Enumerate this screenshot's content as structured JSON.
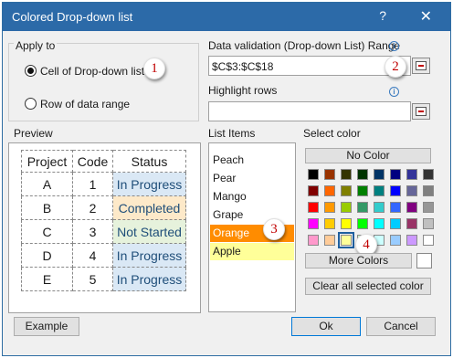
{
  "window": {
    "title": "Colored Drop-down list",
    "help": "?",
    "close": "✕"
  },
  "apply_to": {
    "label": "Apply to",
    "option_cell": "Cell of Drop-down list",
    "option_row": "Row of data range",
    "selected": "cell",
    "badge": "1"
  },
  "range": {
    "label": "Data validation (Drop-down List) Range",
    "value": "$C$3:$C$18",
    "badge": "2",
    "info_icon": "info-icon"
  },
  "highlight_rows": {
    "label": "Highlight rows",
    "value": "",
    "info_icon": "info-icon"
  },
  "preview": {
    "label": "Preview",
    "headers": [
      "Project",
      "Code",
      "Status"
    ],
    "rows": [
      {
        "project": "A",
        "code": "1",
        "status": "In Progress",
        "color": "#dae8f5"
      },
      {
        "project": "B",
        "code": "2",
        "status": "Completed",
        "color": "#fde9c9"
      },
      {
        "project": "C",
        "code": "3",
        "status": "Not Started",
        "color": "#e6f2dc"
      },
      {
        "project": "D",
        "code": "4",
        "status": "In Progress",
        "color": "#dae8f5"
      },
      {
        "project": "E",
        "code": "5",
        "status": "In Progress",
        "color": "#dae8f5"
      }
    ]
  },
  "list_items": {
    "label": "List Items",
    "items": [
      {
        "text": "Peach",
        "bg": "#ffffff",
        "color": "#1a1a1a"
      },
      {
        "text": "Pear",
        "bg": "#ffffff",
        "color": "#1a1a1a"
      },
      {
        "text": "Mango",
        "bg": "#ffffff",
        "color": "#1a1a1a"
      },
      {
        "text": "Grape",
        "bg": "#ffffff",
        "color": "#1a1a1a"
      },
      {
        "text": "Orange",
        "bg": "#ff8c00",
        "color": "#ffffff"
      },
      {
        "text": "Apple",
        "bg": "#ffff99",
        "color": "#1a1a1a"
      }
    ],
    "badge": "3"
  },
  "select_color": {
    "label": "Select color",
    "no_color": "No Color",
    "more_colors": "More Colors",
    "clear_all": "Clear all selected color",
    "badge": "4",
    "selected": {
      "row": 4,
      "col": 2
    },
    "grid": [
      [
        "#000000",
        "#993300",
        "#333300",
        "#003300",
        "#003366",
        "#000080",
        "#333399",
        "#333333"
      ],
      [
        "#800000",
        "#ff6600",
        "#808000",
        "#008000",
        "#008080",
        "#0000ff",
        "#666699",
        "#808080"
      ],
      [
        "#ff0000",
        "#ff9900",
        "#99cc00",
        "#339966",
        "#33cccc",
        "#3366ff",
        "#800080",
        "#969696"
      ],
      [
        "#ff00ff",
        "#ffcc00",
        "#ffff00",
        "#00ff00",
        "#00ffff",
        "#00ccff",
        "#993366",
        "#c0c0c0"
      ],
      [
        "#ff99cc",
        "#ffcc99",
        "#ffff99",
        "#ccffcc",
        "#ccffff",
        "#99ccff",
        "#cc99ff",
        "#ffffff"
      ]
    ]
  },
  "footer": {
    "example": "Example",
    "ok": "Ok",
    "cancel": "Cancel"
  }
}
